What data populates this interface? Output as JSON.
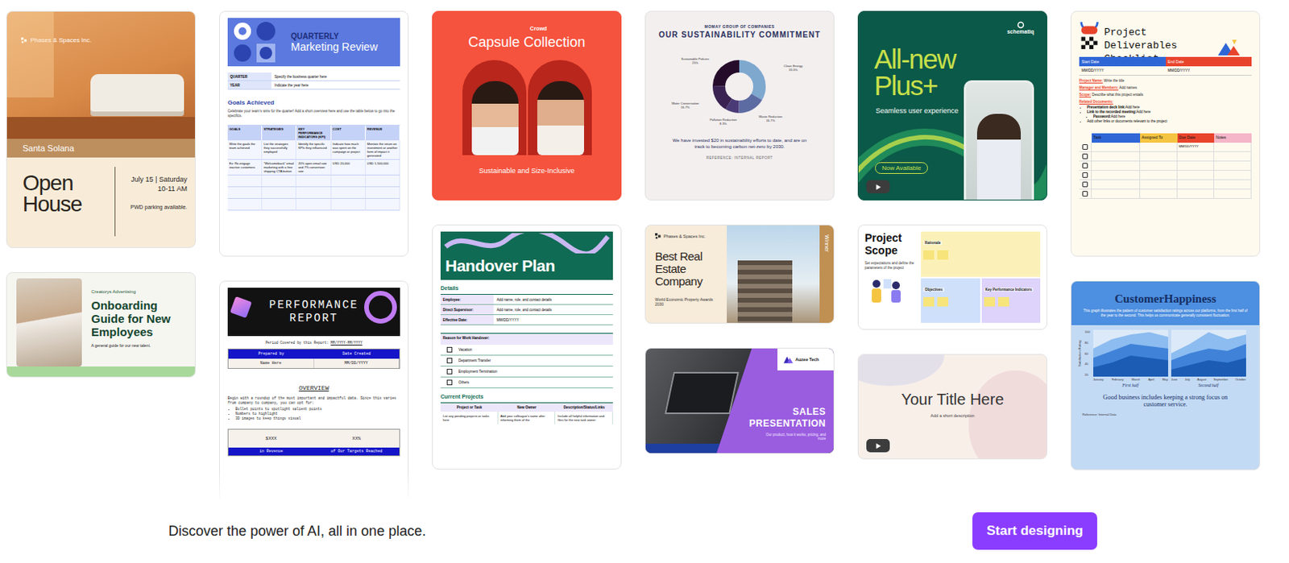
{
  "columns": [
    {
      "cards": [
        {
          "kind": "open-house",
          "brand": "Phases & Spaces Inc.",
          "place": "Santa Solana",
          "title": "Open House",
          "date": "July 15 | Saturday",
          "time": "10-11 AM",
          "note": "PWD parking available."
        },
        {
          "kind": "onboarding",
          "brand": "Creatorys Advertising",
          "title": "Onboarding Guide for New Employees",
          "subtitle": "A general guide for our new talent."
        }
      ]
    },
    {
      "cards": [
        {
          "kind": "quarterly",
          "kicker": "QUARTERLY",
          "title": "Marketing Review",
          "fields": [
            {
              "label": "QUARTER",
              "value": "Specify the business quarter here"
            },
            {
              "label": "YEAR",
              "value": "Indicate the year here"
            }
          ],
          "heading": "Goals Achieved",
          "intro": "Celebrate your team's wins for the quarter! Add a short overview here and use the table below to go into the specifics.",
          "columns": [
            "GOALS",
            "STRATEGIES",
            "KEY PERFORMANCE INDICATORS (KPI)",
            "COST",
            "REVENUE"
          ],
          "rows": [
            [
              "Write the goals the team achieved",
              "List the strategies they successfully employed",
              "Identify the specific KPIs they influenced",
              "Indicate how much was spent on the campaign or project",
              "Mention the return on investment or another form of impact it generated"
            ],
            [
              "Ex: Re-engage inactive customers",
              "\"Welcomeback\" email marketing with a free shipping CTA button",
              "20% open email rate and 7% conversion rate",
              "USD 20,000",
              "USD 1,500,000"
            ],
            [
              "",
              "",
              "",
              "",
              ""
            ],
            [
              "",
              "",
              "",
              "",
              ""
            ],
            [
              "",
              "",
              "",
              "",
              ""
            ]
          ]
        },
        {
          "kind": "performance",
          "title": "PERFORMANCE REPORT",
          "period_label": "Period Covered by this Report:",
          "period": "MM/YYYY-MM/YYYY",
          "meta_columns": [
            "Prepared by",
            "Date Created"
          ],
          "meta_values": [
            "Name Here",
            "MM/DD/YYYY"
          ],
          "heading": "OVERVIEW",
          "intro": "Begin with a roundup of the most important and impactful data. Since this varies from company to company, you can opt for:",
          "bullets": [
            "Bullet points to spotlight salient points",
            "Numbers to highlight",
            "3D images to keep things visual"
          ],
          "stats": [
            {
              "value": "$XXX",
              "label": "in Revenue"
            },
            {
              "value": "XX%",
              "label": "of Our Targets Reached"
            }
          ]
        }
      ]
    },
    {
      "cards": [
        {
          "kind": "capsule",
          "brand": "Crowd",
          "title": "Capsule Collection",
          "subtitle": "Sustainable and Size-Inclusive"
        },
        {
          "kind": "handover",
          "title": "Handover Plan",
          "details_heading": "Details",
          "fields": [
            {
              "label": "Employee:",
              "value": "Add name, role, and contact details"
            },
            {
              "label": "Direct Supervisor:",
              "value": "Add name, role, and contact details"
            },
            {
              "label": "Effective Date:",
              "value": "MM/DD/YYYY"
            }
          ],
          "reason_heading": "Reason for Work Handover:",
          "reasons": [
            {
              "label": "Vacation",
              "checked": false
            },
            {
              "label": "Department Transfer",
              "checked": false
            },
            {
              "label": "Employment Termination",
              "checked": false
            },
            {
              "label": "Others",
              "checked": false
            }
          ],
          "projects_heading": "Current Projects",
          "columns": [
            "Project or Task",
            "New Owner",
            "Description/Status/Links"
          ],
          "rows": [
            [
              "List any pending projects or tasks here",
              "Add your colleague's name after informing them of the",
              "Include all helpful information and files for the new task owner"
            ]
          ]
        }
      ]
    },
    {
      "cards": [
        {
          "kind": "sustainability",
          "org": "MOMAY GROUP OF COMPANIES",
          "title": "OUR SUSTAINABILITY COMMITMENT",
          "segments": [
            {
              "label": "Clean Energy",
              "percent": "33.3%",
              "value": 33.3,
              "color": "#7fa8cf"
            },
            {
              "label": "Waste Reduction",
              "percent": "16.7%",
              "value": 16.7,
              "color": "#5d6ba3"
            },
            {
              "label": "Pollution Reduction",
              "percent": "8.3%",
              "value": 8.3,
              "color": "#4a3b77"
            },
            {
              "label": "Water Conservation",
              "percent": "16.7%",
              "value": 16.7,
              "color": "#3a2352"
            },
            {
              "label": "Sustainable Policies",
              "percent": "25%",
              "value": 25,
              "color": "#260c2b"
            }
          ],
          "text": "We have invested $20 in sustainability efforts to date, and are on track to becoming carbon net-zero by 2030.",
          "reference": "REFERENCE: INTERNAL REPORT"
        },
        {
          "kind": "real-estate",
          "brand": "Phases & Spaces Inc.",
          "title": "Best Real Estate Company",
          "award": "World Economic Property Awards 2030",
          "tag": "Winner"
        },
        {
          "kind": "sales",
          "brand": "Auzee Tech",
          "title": "SALES PRESENTATION",
          "subtitle": "Our product, how it works, pricing, and more"
        }
      ]
    },
    {
      "cards": [
        {
          "kind": "plus",
          "brand": "schematiq",
          "title": "All-new Plus+",
          "subtitle": "Seamless user experience",
          "badge": "Now Available"
        },
        {
          "kind": "scope",
          "title": "Project Scope",
          "subtitle": "Set expectations and define the parameters of the project",
          "notes": [
            {
              "label": "Rationale",
              "color": "#fbf1b8"
            },
            {
              "label": "Objectives",
              "color": "#cfe0fb"
            },
            {
              "label": "Key Performance Indicators",
              "color": "#ddd3fb"
            }
          ]
        },
        {
          "kind": "title-slide",
          "title": "Your Title Here",
          "subtitle": "Add a short description"
        }
      ]
    },
    {
      "cards": [
        {
          "kind": "deliverables",
          "title": "Project Deliverables Checklist",
          "date_columns": [
            {
              "label": "Start Date",
              "color": "#2f66d6"
            },
            {
              "label": "End Date",
              "color": "#e8442c"
            }
          ],
          "date_values": [
            "MM/DD/YYYY",
            "MM/DD/YYYY"
          ],
          "fields": [
            {
              "label": "Project Name:",
              "value": "Write the title"
            },
            {
              "label": "Manager and Members:",
              "value": "Add names"
            },
            {
              "label": "Scope:",
              "value": "Describe what this project entails"
            }
          ],
          "docs_label": "Related Documents:",
          "docs": [
            {
              "label": "Presentation deck link:",
              "value": "Add here",
              "indent": false
            },
            {
              "label": "Link to the recorded meeting:",
              "value": "Add here",
              "indent": false
            },
            {
              "label": "Password:",
              "value": "Add here",
              "indent": true
            },
            {
              "label": "",
              "value": "Add other links or documents relevant to the project",
              "indent": false
            }
          ],
          "columns": [
            {
              "label": "Task",
              "color": "#2f66d6"
            },
            {
              "label": "Assigned To",
              "color": "#f5c542"
            },
            {
              "label": "Due Date",
              "color": "#e8442c"
            },
            {
              "label": "Notes",
              "color": "#f4b6c8"
            }
          ],
          "rows": [
            {
              "checked": false,
              "cells": [
                "",
                "",
                "MM/DD/YYYY",
                ""
              ]
            },
            {
              "checked": false,
              "cells": [
                "",
                "",
                "",
                ""
              ]
            },
            {
              "checked": false,
              "cells": [
                "",
                "",
                "",
                ""
              ]
            },
            {
              "checked": false,
              "cells": [
                "",
                "",
                "",
                ""
              ]
            },
            {
              "checked": false,
              "cells": [
                "",
                "",
                "",
                ""
              ]
            },
            {
              "checked": false,
              "cells": [
                "",
                "",
                "",
                ""
              ]
            }
          ]
        },
        {
          "kind": "customer",
          "title": "CustomerHappiness",
          "description": "This graph illustrates the pattern of customer satisfaction ratings across our platforms, from the first half of the year to the second. This helps us communicate generally consistent fluctuation.",
          "axis": "Satisfaction Rating",
          "ticks": [
            "100",
            "80",
            "60",
            "40",
            "20"
          ],
          "charts": [
            {
              "label": "First half",
              "months": [
                "January",
                "February",
                "March",
                "April",
                "May"
              ],
              "series": [
                {
                  "color": "#8cbcf0",
                  "values": [
                    60,
                    80,
                    90,
                    95,
                    85
                  ]
                },
                {
                  "color": "#3f82d8",
                  "values": [
                    40,
                    55,
                    70,
                    65,
                    60
                  ]
                },
                {
                  "color": "#1c5cb5",
                  "values": [
                    20,
                    30,
                    45,
                    40,
                    35
                  ]
                }
              ]
            },
            {
              "label": "Second half",
              "months": [
                "June",
                "July",
                "August",
                "September",
                "October"
              ],
              "series": [
                {
                  "color": "#8cbcf0",
                  "values": [
                    50,
                    70,
                    95,
                    80,
                    90
                  ]
                },
                {
                  "color": "#3f82d8",
                  "values": [
                    35,
                    50,
                    60,
                    55,
                    70
                  ]
                },
                {
                  "color": "#1c5cb5",
                  "values": [
                    15,
                    25,
                    35,
                    30,
                    40
                  ]
                }
              ]
            }
          ],
          "footer": "Good business includes keeping a strong focus on customer service.",
          "reference": "Reference: Internal Data"
        }
      ]
    }
  ],
  "footer": {
    "tagline": "Discover the power of AI, all in one place.",
    "button": "Start designing"
  }
}
